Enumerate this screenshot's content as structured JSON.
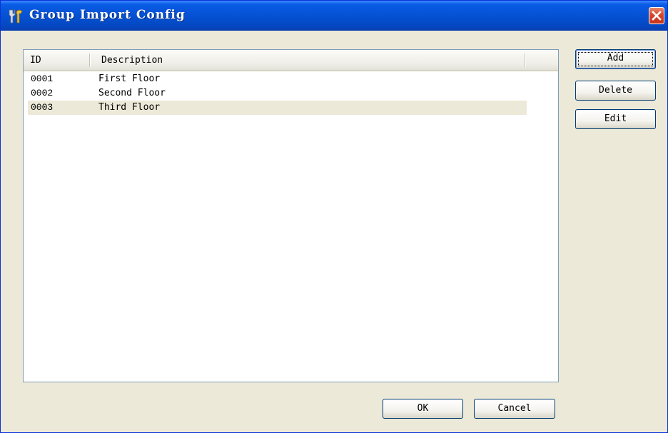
{
  "window": {
    "title": "Group Import Config",
    "icon": "tools-icon",
    "close_icon": "close-icon",
    "accent_color": "#0553d6",
    "close_color": "#d8432b"
  },
  "list": {
    "columns": [
      "ID",
      "Description"
    ],
    "rows": [
      {
        "id": "0001",
        "description": "First Floor",
        "selected": false
      },
      {
        "id": "0002",
        "description": "Second Floor",
        "selected": false
      },
      {
        "id": "0003",
        "description": "Third Floor",
        "selected": true
      }
    ]
  },
  "side_buttons": {
    "add": "Add",
    "delete": "Delete",
    "edit": "Edit"
  },
  "footer_buttons": {
    "ok": "OK",
    "cancel": "Cancel"
  }
}
